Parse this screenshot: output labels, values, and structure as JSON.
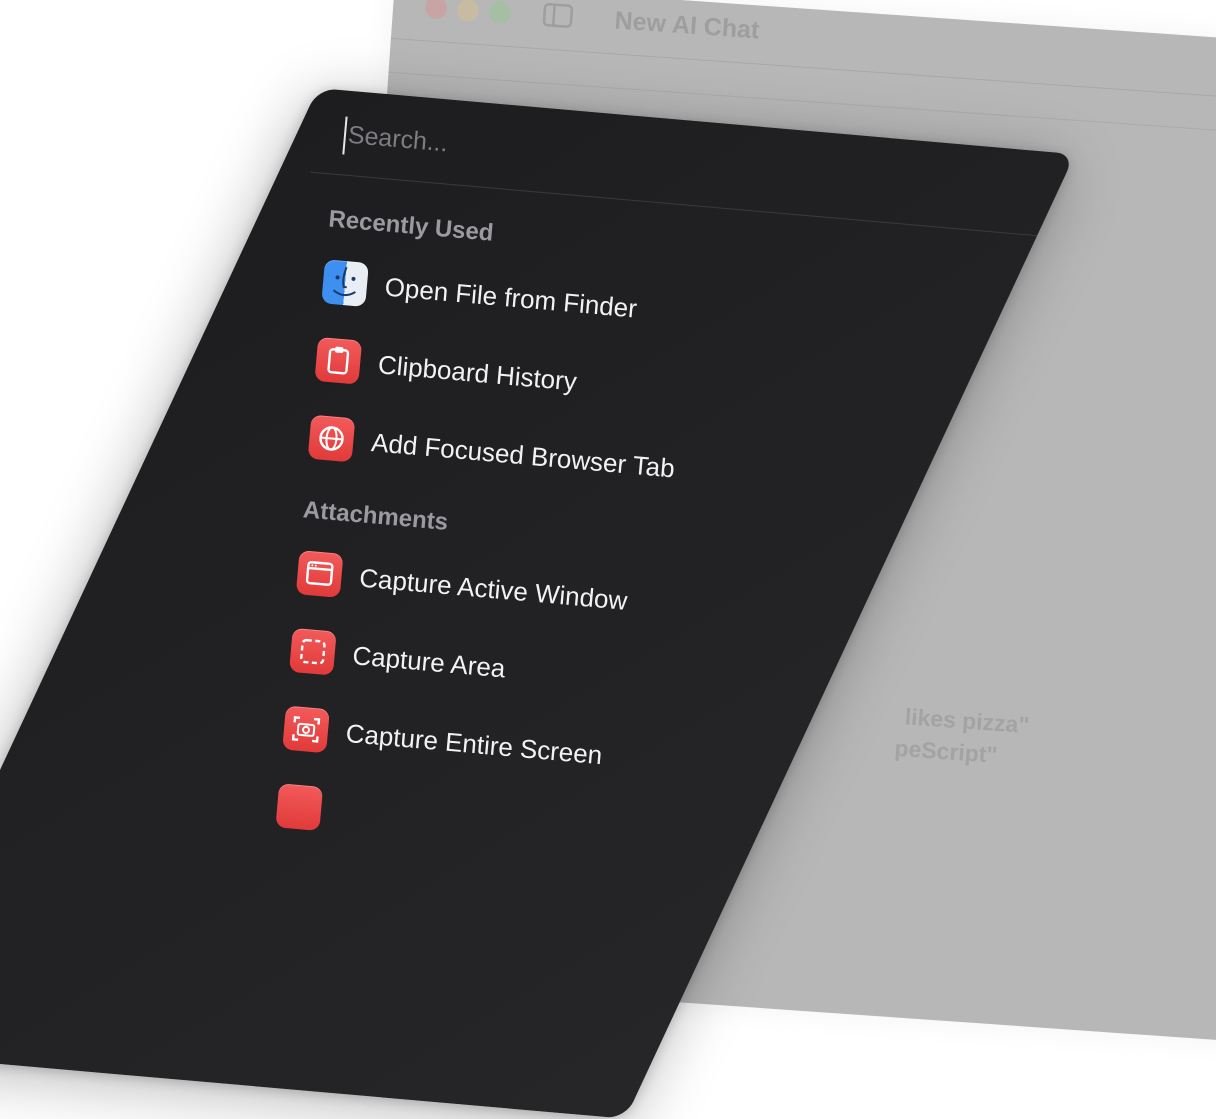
{
  "background_window": {
    "title": "New AI Chat",
    "hints": [
      "likes pizza\"",
      "peScript\""
    ]
  },
  "palette": {
    "search": {
      "placeholder": "Search...",
      "value": ""
    },
    "sections": [
      {
        "header": "Recently Used",
        "items": [
          {
            "label": "Open File from Finder",
            "icon": "finder-icon"
          },
          {
            "label": "Clipboard History",
            "icon": "clipboard-icon"
          },
          {
            "label": "Add Focused Browser Tab",
            "icon": "globe-icon"
          }
        ]
      },
      {
        "header": "Attachments",
        "items": [
          {
            "label": "Capture Active Window",
            "icon": "window-icon"
          },
          {
            "label": "Capture Area",
            "icon": "area-select-icon"
          },
          {
            "label": "Capture Entire Screen",
            "icon": "camera-icon"
          }
        ]
      }
    ]
  },
  "colors": {
    "palette_bg": "#1f1f21",
    "icon_red": "#e84545",
    "finder_blue": "#3d8ff0",
    "text_primary": "#f2f2f2",
    "text_section": "#9a9aa0"
  }
}
